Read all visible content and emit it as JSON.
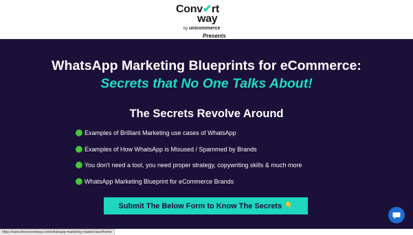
{
  "header": {
    "logo": {
      "line1_a": "Conv",
      "line1_b": "rt",
      "line2": "way",
      "by": "by",
      "company": "unicommerce"
    },
    "presents": "Presents"
  },
  "hero": {
    "title": "WhatsApp Marketing Blueprints for eCommerce:",
    "subtitle": "Secrets that No One Talks About!",
    "subheading": "The Secrets Revolve Around",
    "bullets": [
      "Examples of Brilliant Marketing use cases of WhatsApp",
      "Examples of How WhatsApp is Misused / Spammed by Brands",
      "You don't need a tool, you need proper strategy, copywriting skills & much more",
      "WhatsApp Marketing Blueprint for eCommerce Brands"
    ],
    "cta_label": "Submit The Below Form to Know The Secrets",
    "cta_icon": "👇"
  },
  "status_url": "https://www.theconvertway.com/whatsapp-marketing-masterclass#home",
  "colors": {
    "hero_bg": "#1a1038",
    "accent": "#1fd6bf",
    "bullet": "#46c93a",
    "chat": "#1f6fd1"
  },
  "icons": [
    "check-icon",
    "bullet-dot-icon",
    "pointing-down-icon",
    "chat-icon"
  ]
}
